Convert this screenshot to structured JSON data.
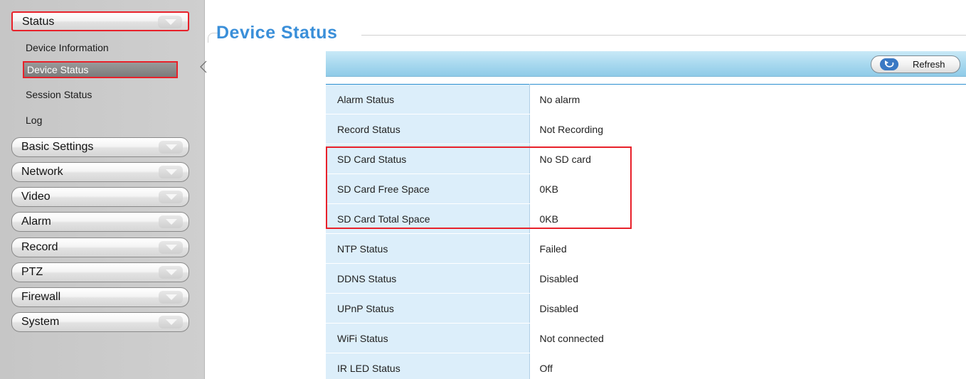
{
  "sidebar": {
    "status": {
      "label": "Status"
    },
    "status_items": [
      {
        "label": "Device Information"
      },
      {
        "label": "Device Status"
      },
      {
        "label": "Session Status"
      },
      {
        "label": "Log"
      }
    ],
    "menus": [
      {
        "label": "Basic Settings"
      },
      {
        "label": "Network"
      },
      {
        "label": "Video"
      },
      {
        "label": "Alarm"
      },
      {
        "label": "Record"
      },
      {
        "label": "PTZ"
      },
      {
        "label": "Firewall"
      },
      {
        "label": "System"
      }
    ]
  },
  "main": {
    "title": "Device Status",
    "refresh_label": "Refresh",
    "rows": [
      {
        "label": "Alarm Status",
        "value": "No alarm"
      },
      {
        "label": "Record Status",
        "value": "Not Recording"
      },
      {
        "label": "SD Card Status",
        "value": "No SD card"
      },
      {
        "label": "SD Card Free Space",
        "value": "0KB"
      },
      {
        "label": "SD Card Total Space",
        "value": "0KB"
      },
      {
        "label": "NTP Status",
        "value": "Failed"
      },
      {
        "label": "DDNS Status",
        "value": "Disabled"
      },
      {
        "label": "UPnP Status",
        "value": "Disabled"
      },
      {
        "label": "WiFi Status",
        "value": "Not connected"
      },
      {
        "label": "IR LED Status",
        "value": "Off"
      }
    ]
  },
  "colors": {
    "accent_title": "#3a8fd9",
    "highlight": "#e8212a",
    "header_bar": "#a9d9ef",
    "label_cell": "#dceefa"
  },
  "icons": {
    "menu_arrow": "chevron-down-icon",
    "refresh": "refresh-icon"
  }
}
